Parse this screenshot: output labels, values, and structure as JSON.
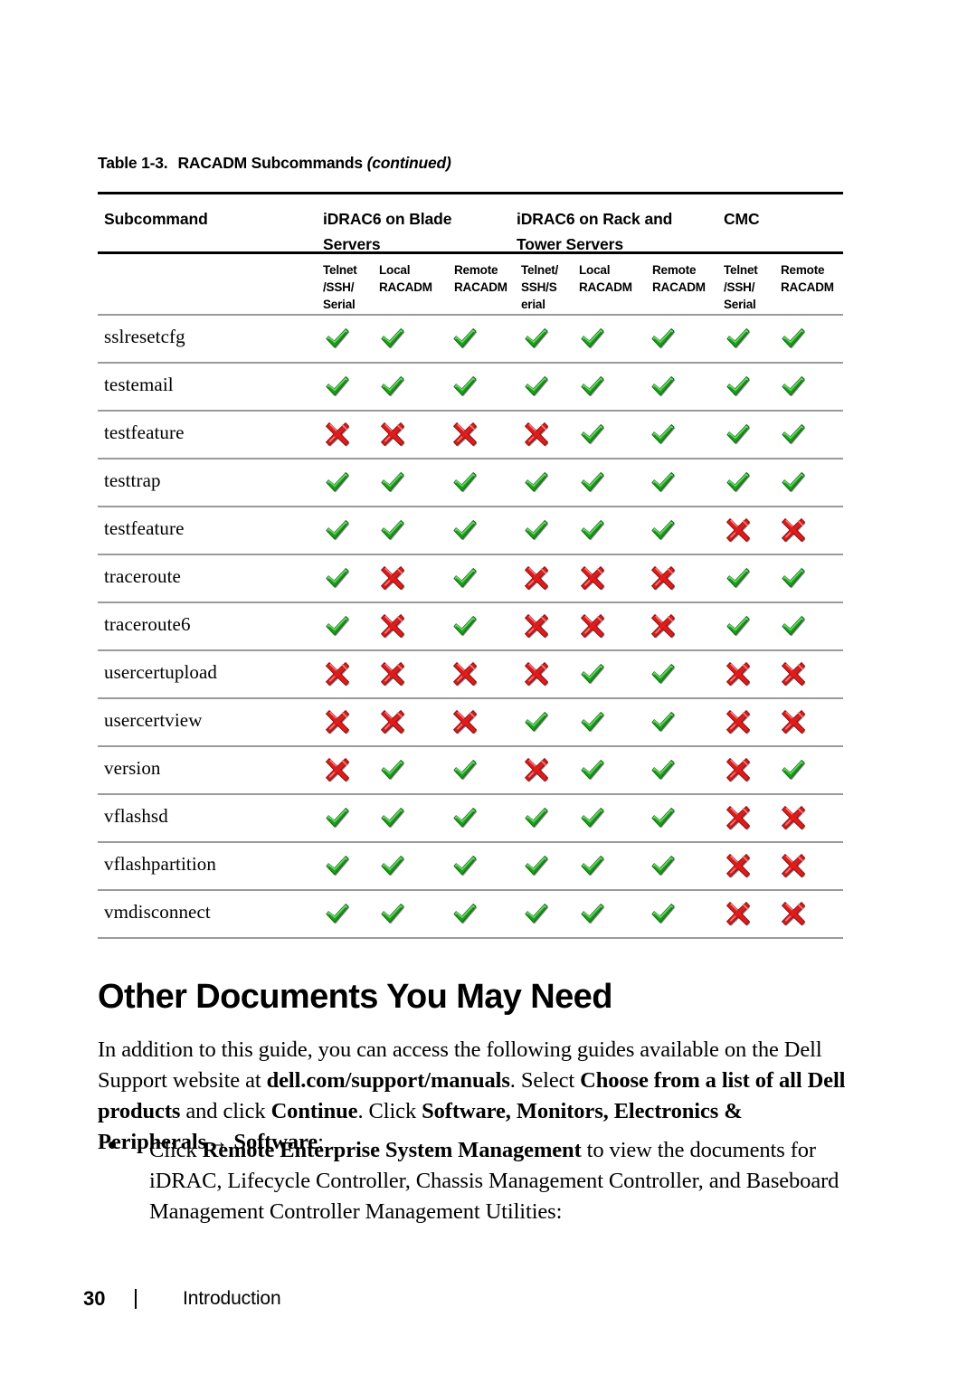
{
  "table": {
    "caption_number": "Table 1-3.",
    "caption_title": "RACADM Subcommands",
    "caption_continued": "(continued)",
    "header_groups": [
      {
        "label": "Subcommand"
      },
      {
        "label": "iDRAC6 on Blade Servers"
      },
      {
        "label": "iDRAC6 on Rack and Tower Servers"
      },
      {
        "label": "CMC"
      }
    ],
    "sub_headers": [
      "Telnet /SSH/ Serial",
      "Local RACADM",
      "Remote RACADM",
      "Telnet/ SSH/S erial",
      "Local RACADM",
      "Remote RACADM",
      "Telnet /SSH/ Serial",
      "Remote RACADM"
    ],
    "sub_headers_lines": [
      [
        "Telnet",
        "/SSH/",
        "Serial"
      ],
      [
        "Local",
        "RACADM"
      ],
      [
        "Remote",
        "RACADM"
      ],
      [
        "Telnet/",
        "SSH/S",
        "erial"
      ],
      [
        "Local",
        "RACADM"
      ],
      [
        "Remote",
        "RACADM"
      ],
      [
        "Telnet",
        "/SSH/",
        "Serial"
      ],
      [
        "Remote",
        "RACADM"
      ]
    ],
    "icons": {
      "supported": "green-check-icon",
      "unsupported": "red-cross-icon"
    },
    "colors": {
      "check_green": "#19a119",
      "cross_red": "#e01b1b",
      "rule_dark": "#000000",
      "rule_light": "#9a9a9a"
    },
    "rows": [
      {
        "subcommand": "sslresetcfg",
        "support": [
          1,
          1,
          1,
          1,
          1,
          1,
          1,
          1
        ]
      },
      {
        "subcommand": "testemail",
        "support": [
          1,
          1,
          1,
          1,
          1,
          1,
          1,
          1
        ]
      },
      {
        "subcommand": "testfeature",
        "support": [
          0,
          0,
          0,
          0,
          1,
          1,
          1,
          1
        ]
      },
      {
        "subcommand": "testtrap",
        "support": [
          1,
          1,
          1,
          1,
          1,
          1,
          1,
          1
        ]
      },
      {
        "subcommand": "testfeature",
        "support": [
          1,
          1,
          1,
          1,
          1,
          1,
          0,
          0
        ]
      },
      {
        "subcommand": "traceroute",
        "support": [
          1,
          0,
          1,
          0,
          0,
          0,
          1,
          1
        ]
      },
      {
        "subcommand": "traceroute6",
        "support": [
          1,
          0,
          1,
          0,
          0,
          0,
          1,
          1
        ]
      },
      {
        "subcommand": "usercertupload",
        "support": [
          0,
          0,
          0,
          0,
          1,
          1,
          0,
          0
        ]
      },
      {
        "subcommand": "usercertview",
        "support": [
          0,
          0,
          0,
          1,
          1,
          1,
          0,
          0
        ]
      },
      {
        "subcommand": "version",
        "support": [
          0,
          1,
          1,
          0,
          1,
          1,
          0,
          1
        ]
      },
      {
        "subcommand": "vflashsd",
        "support": [
          1,
          1,
          1,
          1,
          1,
          1,
          0,
          0
        ]
      },
      {
        "subcommand": "vflashpartition",
        "support": [
          1,
          1,
          1,
          1,
          1,
          1,
          0,
          0
        ]
      },
      {
        "subcommand": "vmdisconnect",
        "support": [
          1,
          1,
          1,
          1,
          1,
          1,
          0,
          0
        ]
      }
    ]
  },
  "section": {
    "heading": "Other Documents You May Need",
    "paragraph_parts": [
      {
        "text": "In addition to this guide, you can access the following guides available on the Dell Support website at ",
        "bold": false
      },
      {
        "text": "dell.com/support/manuals",
        "bold": true
      },
      {
        "text": ". Select ",
        "bold": false
      },
      {
        "text": "Choose from a list of all Dell products",
        "bold": true
      },
      {
        "text": " and click ",
        "bold": false
      },
      {
        "text": "Continue",
        "bold": true
      },
      {
        "text": ". Click ",
        "bold": false
      },
      {
        "text": "Software, Monitors, Electronics & Peripherals→ Software",
        "bold": true
      },
      {
        "text": ":",
        "bold": false
      }
    ],
    "bullet_parts": [
      {
        "text": "Click ",
        "bold": false
      },
      {
        "text": "Remote Enterprise System Management",
        "bold": true
      },
      {
        "text": " to view the documents for iDRAC, Lifecycle Controller, Chassis Management Controller, and Baseboard Management Controller Management Utilities:",
        "bold": false
      }
    ]
  },
  "footer": {
    "page_number": "30",
    "separator": "|",
    "chapter_title": "Introduction"
  }
}
